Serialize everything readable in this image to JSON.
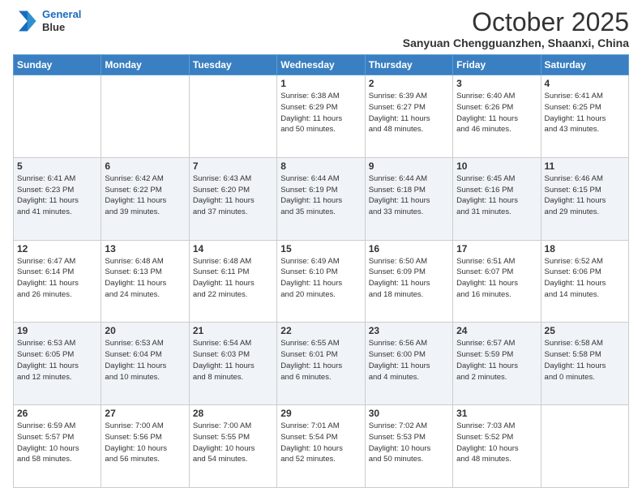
{
  "logo": {
    "line1": "General",
    "line2": "Blue"
  },
  "title": "October 2025",
  "location": "Sanyuan Chengguanzhen, Shaanxi, China",
  "days_header": [
    "Sunday",
    "Monday",
    "Tuesday",
    "Wednesday",
    "Thursday",
    "Friday",
    "Saturday"
  ],
  "weeks": [
    [
      {
        "day": "",
        "info": ""
      },
      {
        "day": "",
        "info": ""
      },
      {
        "day": "",
        "info": ""
      },
      {
        "day": "1",
        "info": "Sunrise: 6:38 AM\nSunset: 6:29 PM\nDaylight: 11 hours\nand 50 minutes."
      },
      {
        "day": "2",
        "info": "Sunrise: 6:39 AM\nSunset: 6:27 PM\nDaylight: 11 hours\nand 48 minutes."
      },
      {
        "day": "3",
        "info": "Sunrise: 6:40 AM\nSunset: 6:26 PM\nDaylight: 11 hours\nand 46 minutes."
      },
      {
        "day": "4",
        "info": "Sunrise: 6:41 AM\nSunset: 6:25 PM\nDaylight: 11 hours\nand 43 minutes."
      }
    ],
    [
      {
        "day": "5",
        "info": "Sunrise: 6:41 AM\nSunset: 6:23 PM\nDaylight: 11 hours\nand 41 minutes."
      },
      {
        "day": "6",
        "info": "Sunrise: 6:42 AM\nSunset: 6:22 PM\nDaylight: 11 hours\nand 39 minutes."
      },
      {
        "day": "7",
        "info": "Sunrise: 6:43 AM\nSunset: 6:20 PM\nDaylight: 11 hours\nand 37 minutes."
      },
      {
        "day": "8",
        "info": "Sunrise: 6:44 AM\nSunset: 6:19 PM\nDaylight: 11 hours\nand 35 minutes."
      },
      {
        "day": "9",
        "info": "Sunrise: 6:44 AM\nSunset: 6:18 PM\nDaylight: 11 hours\nand 33 minutes."
      },
      {
        "day": "10",
        "info": "Sunrise: 6:45 AM\nSunset: 6:16 PM\nDaylight: 11 hours\nand 31 minutes."
      },
      {
        "day": "11",
        "info": "Sunrise: 6:46 AM\nSunset: 6:15 PM\nDaylight: 11 hours\nand 29 minutes."
      }
    ],
    [
      {
        "day": "12",
        "info": "Sunrise: 6:47 AM\nSunset: 6:14 PM\nDaylight: 11 hours\nand 26 minutes."
      },
      {
        "day": "13",
        "info": "Sunrise: 6:48 AM\nSunset: 6:13 PM\nDaylight: 11 hours\nand 24 minutes."
      },
      {
        "day": "14",
        "info": "Sunrise: 6:48 AM\nSunset: 6:11 PM\nDaylight: 11 hours\nand 22 minutes."
      },
      {
        "day": "15",
        "info": "Sunrise: 6:49 AM\nSunset: 6:10 PM\nDaylight: 11 hours\nand 20 minutes."
      },
      {
        "day": "16",
        "info": "Sunrise: 6:50 AM\nSunset: 6:09 PM\nDaylight: 11 hours\nand 18 minutes."
      },
      {
        "day": "17",
        "info": "Sunrise: 6:51 AM\nSunset: 6:07 PM\nDaylight: 11 hours\nand 16 minutes."
      },
      {
        "day": "18",
        "info": "Sunrise: 6:52 AM\nSunset: 6:06 PM\nDaylight: 11 hours\nand 14 minutes."
      }
    ],
    [
      {
        "day": "19",
        "info": "Sunrise: 6:53 AM\nSunset: 6:05 PM\nDaylight: 11 hours\nand 12 minutes."
      },
      {
        "day": "20",
        "info": "Sunrise: 6:53 AM\nSunset: 6:04 PM\nDaylight: 11 hours\nand 10 minutes."
      },
      {
        "day": "21",
        "info": "Sunrise: 6:54 AM\nSunset: 6:03 PM\nDaylight: 11 hours\nand 8 minutes."
      },
      {
        "day": "22",
        "info": "Sunrise: 6:55 AM\nSunset: 6:01 PM\nDaylight: 11 hours\nand 6 minutes."
      },
      {
        "day": "23",
        "info": "Sunrise: 6:56 AM\nSunset: 6:00 PM\nDaylight: 11 hours\nand 4 minutes."
      },
      {
        "day": "24",
        "info": "Sunrise: 6:57 AM\nSunset: 5:59 PM\nDaylight: 11 hours\nand 2 minutes."
      },
      {
        "day": "25",
        "info": "Sunrise: 6:58 AM\nSunset: 5:58 PM\nDaylight: 11 hours\nand 0 minutes."
      }
    ],
    [
      {
        "day": "26",
        "info": "Sunrise: 6:59 AM\nSunset: 5:57 PM\nDaylight: 10 hours\nand 58 minutes."
      },
      {
        "day": "27",
        "info": "Sunrise: 7:00 AM\nSunset: 5:56 PM\nDaylight: 10 hours\nand 56 minutes."
      },
      {
        "day": "28",
        "info": "Sunrise: 7:00 AM\nSunset: 5:55 PM\nDaylight: 10 hours\nand 54 minutes."
      },
      {
        "day": "29",
        "info": "Sunrise: 7:01 AM\nSunset: 5:54 PM\nDaylight: 10 hours\nand 52 minutes."
      },
      {
        "day": "30",
        "info": "Sunrise: 7:02 AM\nSunset: 5:53 PM\nDaylight: 10 hours\nand 50 minutes."
      },
      {
        "day": "31",
        "info": "Sunrise: 7:03 AM\nSunset: 5:52 PM\nDaylight: 10 hours\nand 48 minutes."
      },
      {
        "day": "",
        "info": ""
      }
    ]
  ]
}
